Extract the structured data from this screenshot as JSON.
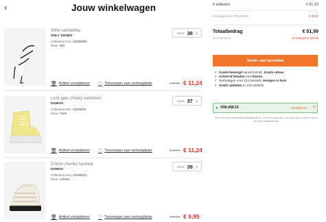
{
  "header": {
    "back_icon": "chevron-left-icon",
    "title": "Jouw winkelwagen"
  },
  "items": [
    {
      "name": "Witte sandaletta",
      "brand": "ONLY SHOES",
      "article_label": "Artikelnummer:",
      "article": "12508291",
      "color_label": "Kleur:",
      "color": "Wit",
      "size_label": "Maat:",
      "size": "38",
      "remove_label": "Artikel verwijderen",
      "wishlist_label": "Toevoegen aan verlanglijstje",
      "old_price": "€ 39,99",
      "price": "€ 11,24"
    },
    {
      "name": "Licht gele chunky veterboot",
      "brand": "OXMOX",
      "article_label": "Artikelnummer:",
      "article": "11118210",
      "color_label": "Kleur:",
      "color": "Geel",
      "size_label": "Maat:",
      "size": "37",
      "remove_label": "Artikel verwijderen",
      "wishlist_label": "Toevoegen aan verlanglijstje",
      "old_price": "€ 42,99",
      "price": "€ 11,24"
    },
    {
      "name": "Crème chunky sandaal",
      "brand": "OXMOX",
      "article_label": "Artikelnummer:",
      "article": "12308221",
      "color_label": "Kleur:",
      "color": "Crème",
      "size_label": "Maat:",
      "size": "39",
      "remove_label": "Artikel verwijderen",
      "wishlist_label": "Toevoegen aan verlanglijstje",
      "old_price": "€ 39,99",
      "price": "€ 9,99"
    }
  ],
  "summary": {
    "count_label": "6 artikelen",
    "count_value": "€ 61,19",
    "discount_label": "Kortingscode ONLINE15",
    "discount_value": "- € 9,20",
    "total_label": "Totaalbedrag",
    "total_value": "€ 51,99",
    "vat_label": "Inclusief BTW",
    "saved_label": "Je bespaart € 192,95",
    "checkout_label": "Verder met bestellen"
  },
  "usps": [
    {
      "strong": "Gratis bezorgd",
      "rest": " vanaf €19,90. ",
      "strong2": "Gratis retour"
    },
    {
      "strong": "Achteraf betalen",
      "rest": " met ",
      "strong2": "Klarna"
    },
    {
      "strong": "",
      "rest": "Werkdagen voor 21u besteld, ",
      "strong2": "morgen in huis"
    },
    {
      "strong": "Gratis ophalen",
      "rest": " in 143 winkels",
      "strong2": ""
    }
  ],
  "voucher": {
    "code": "ONLINE15",
    "remove_label": "Verwijderen",
    "note": "Voer hier een persoonlijke kortingscode in. Heb je een giftcard, voer deze dan in bij het kiezen van een betaalmethode."
  },
  "colors": {
    "accent": "#f2752b",
    "price_red": "#e8342e",
    "success": "#3aa550"
  }
}
